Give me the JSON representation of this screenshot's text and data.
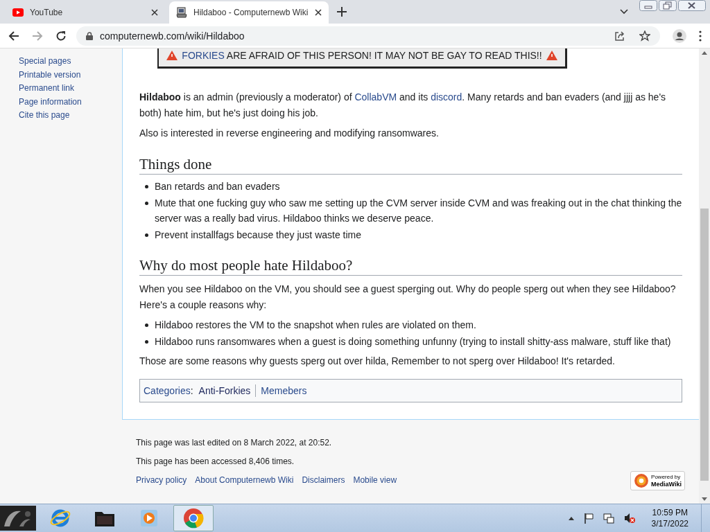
{
  "browser": {
    "tabs": [
      {
        "title": "YouTube",
        "selected": false
      },
      {
        "title": "Hildaboo - Computernewb Wiki",
        "selected": true
      }
    ],
    "url": "computernewb.com/wiki/Hildaboo"
  },
  "sidebar": {
    "items": [
      "Special pages",
      "Printable version",
      "Permanent link",
      "Page information",
      "Cite this page"
    ]
  },
  "article": {
    "banner": [
      {
        "kind": "link",
        "text": "FORKIES"
      },
      {
        "kind": "text",
        "text": " ARE AFRAID OF THIS PERSON! IT MAY NOT BE GAY TO READ THIS!!"
      }
    ],
    "intro": [
      [
        {
          "kind": "bold",
          "text": "Hildaboo"
        },
        {
          "kind": "text",
          "text": " is an admin (previously a moderator) of "
        },
        {
          "kind": "link",
          "text": "CollabVM"
        },
        {
          "kind": "text",
          "text": " and its "
        },
        {
          "kind": "link",
          "text": "discord"
        },
        {
          "kind": "text",
          "text": ". Many retards and ban evaders (and jjjj as he's both) hate him, but he's just doing his job."
        }
      ],
      [
        {
          "kind": "text",
          "text": "Also is interested in reverse engineering and modifying ransomwares."
        }
      ]
    ],
    "sections": [
      {
        "heading": "Things done",
        "list": [
          "Ban retards and ban evaders",
          "Mute that one fucking guy who saw me setting up the CVM server inside CVM and was freaking out in the chat thinking the server was a really bad virus. Hildaboo thinks we deserve peace.",
          "Prevent installfags because they just waste time"
        ]
      },
      {
        "heading": "Why do most people hate Hildaboo?",
        "before": [
          "When you see Hildaboo on the VM, you should see a guest sperging out. Why do people sperg out when they see Hildaboo? Here's a couple reasons why:"
        ],
        "list": [
          "Hildaboo restores the VM to the snapshot when rules are violated on them.",
          "Hildaboo runs ransomwares when a guest is doing something unfunny (trying to install shitty-ass malware, stuff like that)"
        ],
        "after": [
          "Those are some reasons why guests sperg out over hilda, Remember to not sperg over Hildaboo! It's retarded."
        ]
      }
    ],
    "categories": {
      "label": "Categories",
      "colon": ":",
      "items": [
        "Anti-Forkies",
        "Memebers"
      ]
    }
  },
  "footer": {
    "info": [
      "This page was last edited on 8 March 2022, at 20:52.",
      "This page has been accessed 8,406 times."
    ],
    "links": [
      "Privacy policy",
      "About Computernewb Wiki",
      "Disclaimers",
      "Mobile view"
    ],
    "badge": [
      "Powered by",
      "MediaWiki"
    ]
  },
  "taskbar": {
    "items": [
      {
        "selected": false
      },
      {
        "selected": false
      },
      {
        "selected": false
      },
      {
        "selected": true
      }
    ],
    "time": "10:59 PM",
    "date": "3/17/2022"
  }
}
